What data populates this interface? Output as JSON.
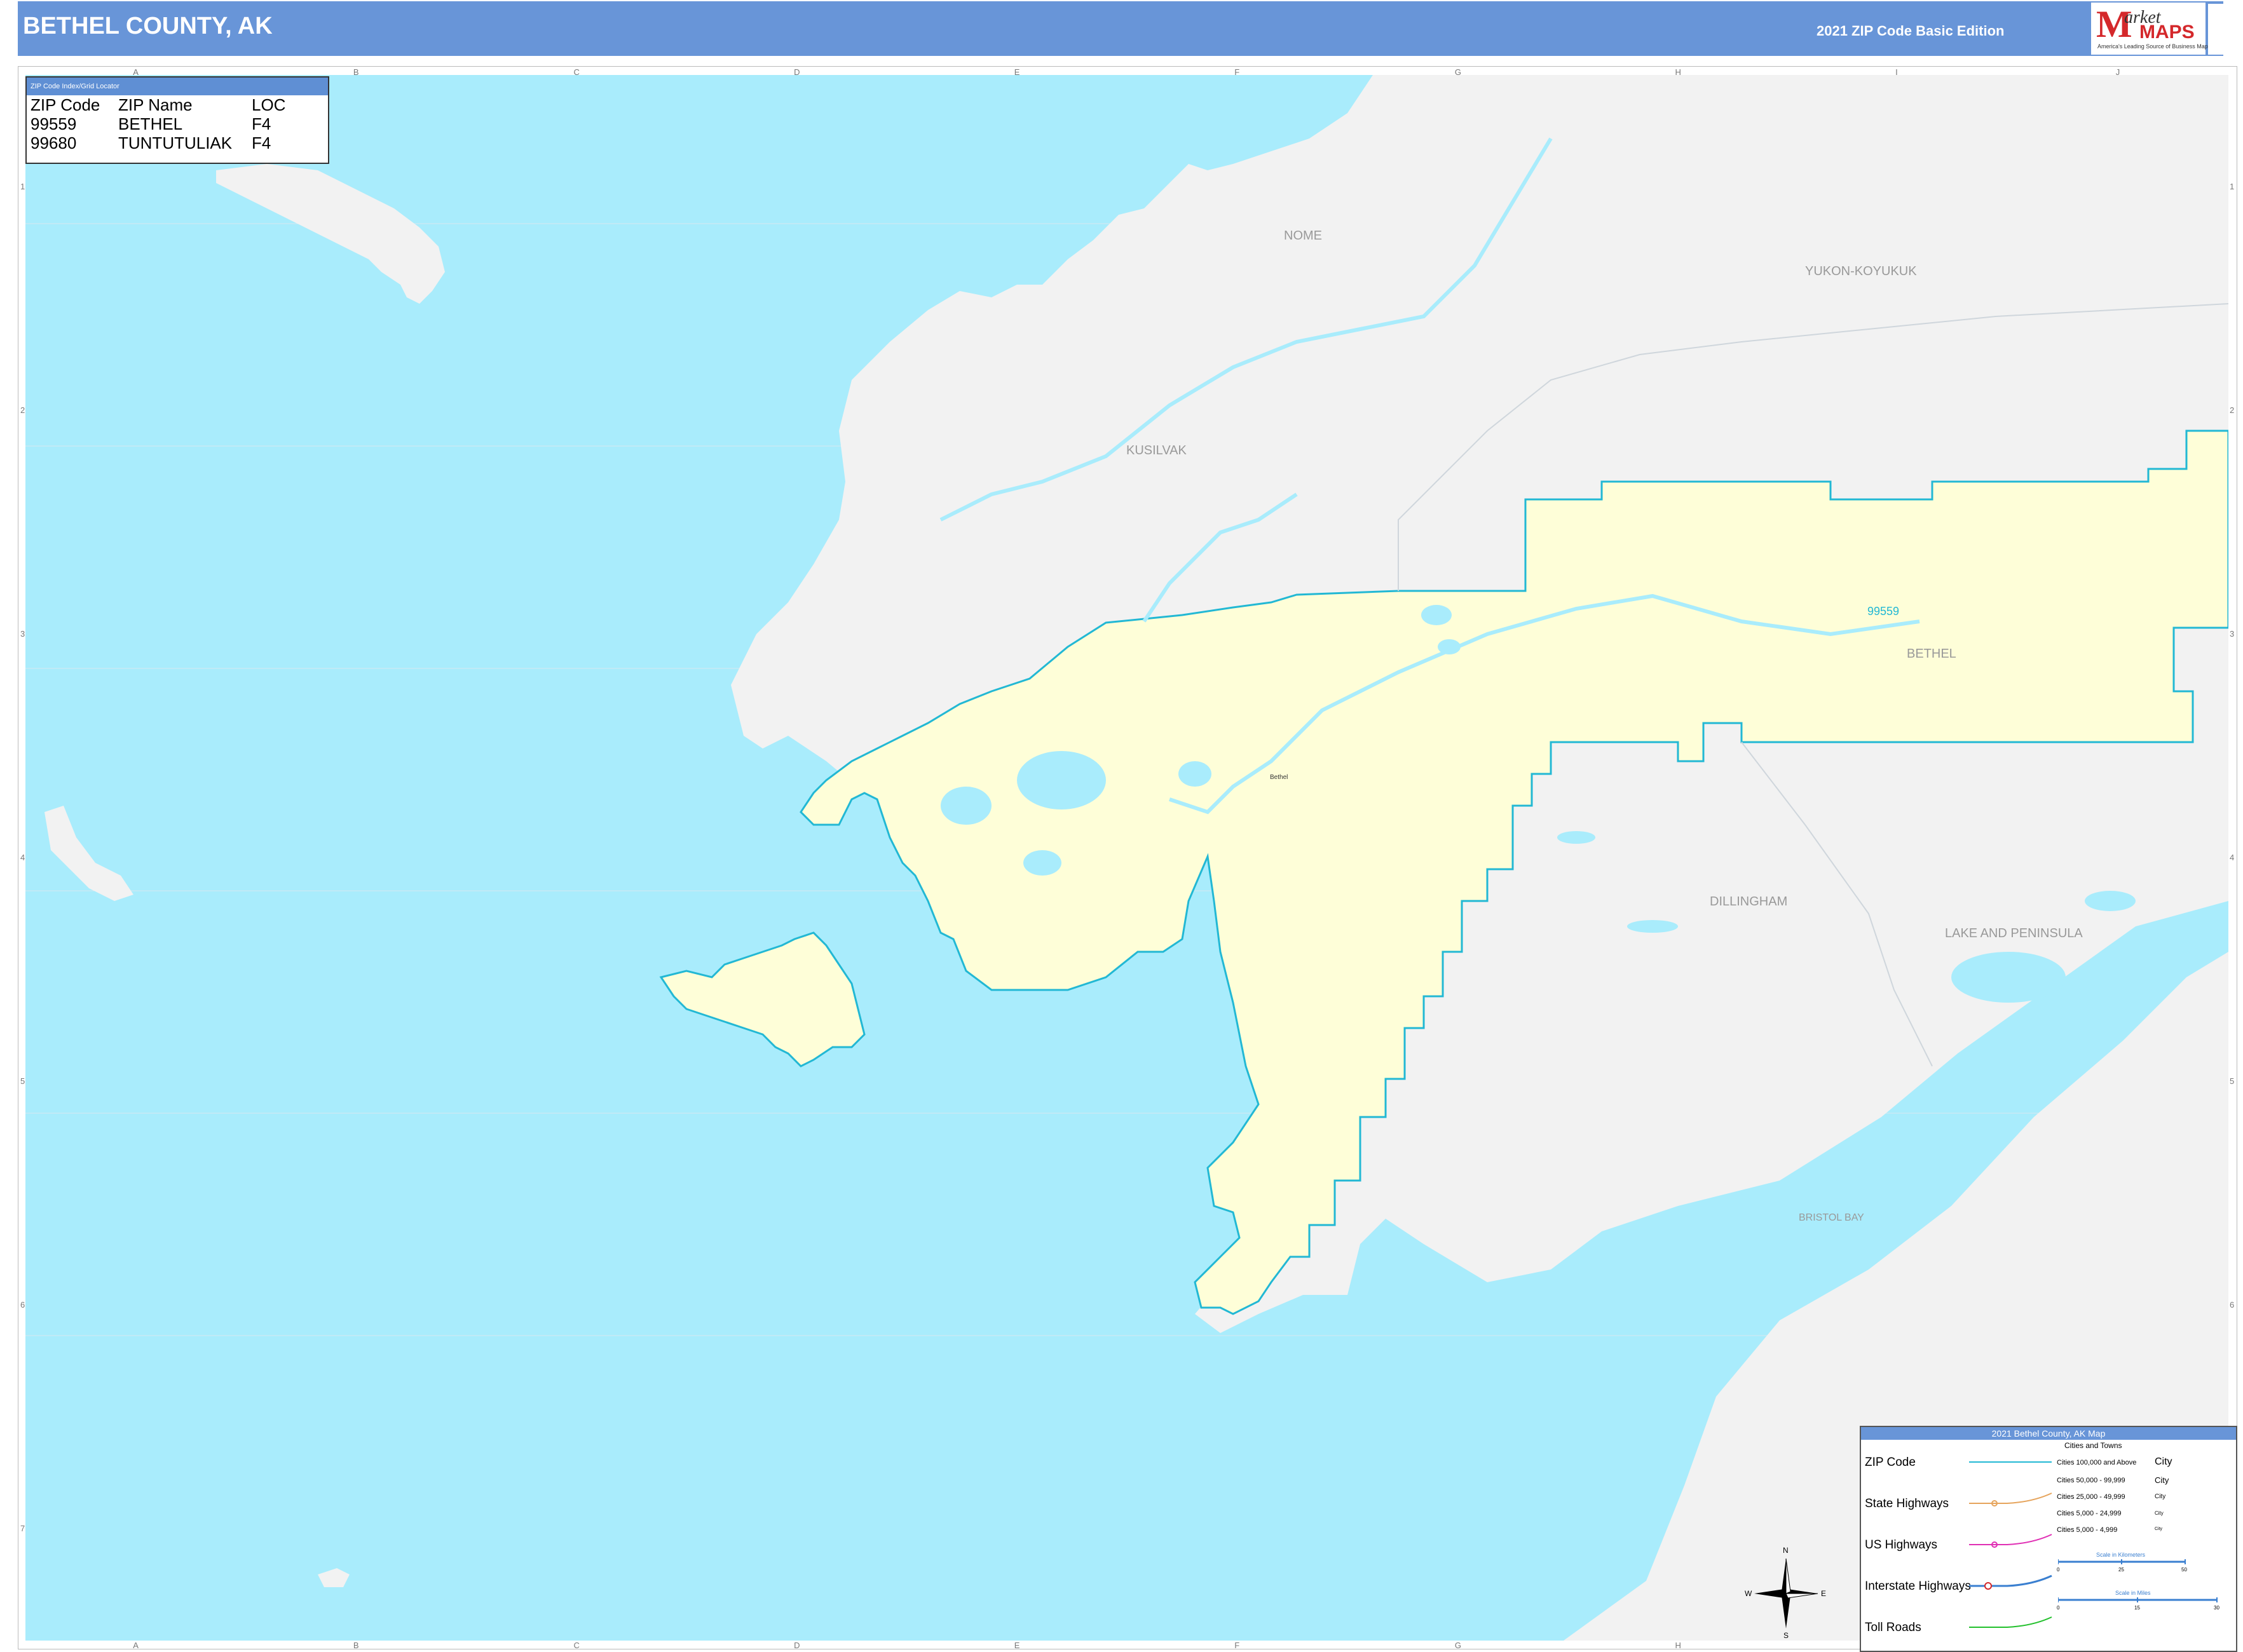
{
  "header": {
    "title": "BETHEL COUNTY, AK",
    "edition": "2021 ZIP Code Basic Edition",
    "logo": {
      "m": "M",
      "arket": "arket",
      "maps": "MAPS",
      "tagline": "America's Leading Source of Business Maps"
    }
  },
  "grid": {
    "columns": [
      "A",
      "B",
      "C",
      "D",
      "E",
      "F",
      "G",
      "H",
      "I",
      "J"
    ],
    "rows": [
      "1",
      "2",
      "3",
      "4",
      "5",
      "6",
      "7"
    ]
  },
  "places": {
    "nome": "NOME",
    "yukon": "YUKON-KOYUKUK",
    "kusilvak": "KUSILVAK",
    "bethel": "BETHEL",
    "dillingham": "DILLINGHAM",
    "lake": "LAKE AND PENINSULA",
    "bristol": "BRISTOL BAY",
    "zip": "99559",
    "city": "Bethel"
  },
  "index": {
    "header": "ZIP Code Index/Grid Locator",
    "columns": [
      "ZIP Code",
      "ZIP Name",
      "LOC"
    ],
    "rows": [
      [
        "99559",
        "BETHEL",
        "F4"
      ],
      [
        "99680",
        "TUNTUTULIAK",
        "F4"
      ]
    ]
  },
  "legend": {
    "title": "2021 Bethel County, AK Map",
    "cities_title": "Cities and Towns",
    "items": [
      "ZIP Code",
      "State Highways",
      "US Highways",
      "Interstate Highways",
      "Toll Roads"
    ],
    "cities": [
      "Cities 100,000 and Above",
      "Cities 50,000 - 99,999",
      "Cities 25,000 - 49,999",
      "Cities 5,000 - 24,999",
      "Cities 5,000 - 4,999"
    ],
    "city_sample": "City",
    "scale_km": "Scale in Kilometers",
    "scale_mi": "Scale in Miles",
    "km_ticks": [
      "0",
      "25",
      "50"
    ],
    "mi_ticks": [
      "0",
      "15",
      "30"
    ]
  },
  "compass": {
    "n": "N",
    "s": "S",
    "e": "E",
    "w": "W"
  },
  "colors": {
    "water": "#a9ecfc",
    "land": "#f2f2f2",
    "county": "#fefed8",
    "boundary": "#22b8d4",
    "header": "#6895d8",
    "state_hwy": "#e6a45c",
    "us_hwy": "#e02fb4",
    "interstate": "#3a7fd0",
    "toll": "#22c02c"
  }
}
